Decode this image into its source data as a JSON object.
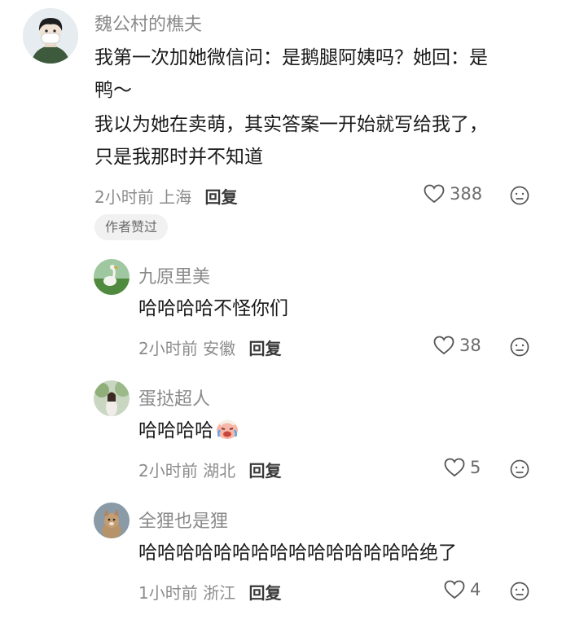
{
  "main_comment": {
    "username": "魏公村的樵夫",
    "text_lines": [
      "我第一次加她微信问：是鹅腿阿姨吗？她回：是",
      "鸭～",
      "我以为她在卖萌，其实答案一开始就写给我了，",
      "只是我那时并不知道"
    ],
    "time": "2小时前",
    "location": "上海",
    "reply_label": "回复",
    "likes": "388",
    "badge": "作者赞过"
  },
  "replies": [
    {
      "username": "九原里美",
      "text": "哈哈哈哈不怪你们",
      "time": "2小时前",
      "location": "安徽",
      "reply_label": "回复",
      "likes": "38"
    },
    {
      "username": "蛋挞超人",
      "text": "哈哈哈哈",
      "emoji": "crying-laughing-face-emoji",
      "time": "2小时前",
      "location": "湖北",
      "reply_label": "回复",
      "likes": "5"
    },
    {
      "username": "全狸也是狸",
      "text": "哈哈哈哈哈哈哈哈哈哈哈哈哈哈哈绝了",
      "time": "1小时前",
      "location": "浙江",
      "reply_label": "回复",
      "likes": "4"
    }
  ],
  "icons": {
    "like": "heart-outline-icon",
    "dislike": "frown-face-icon"
  }
}
